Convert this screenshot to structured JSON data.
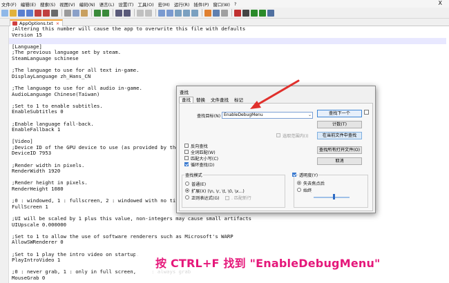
{
  "menu": {
    "items": [
      "文件(F)",
      "编辑(E)",
      "搜索(S)",
      "视图(V)",
      "编码(N)",
      "语言(L)",
      "设置(T)",
      "工具(O)",
      "宏(M)",
      "运行(R)",
      "插件(P)",
      "窗口(W)",
      "?"
    ],
    "close": "X"
  },
  "tab": {
    "label": "AppOptions.txt",
    "close": "×"
  },
  "editor": {
    "lines": [
      ";Altering this number will cause the app to overwrite this file with defaults",
      "Version 15",
      "",
      "[Language]",
      ";The previous language set by steam.",
      "SteamLanguage schinese",
      "",
      ";The language to use for all text in-game.",
      "DisplayLanguage zh_Hans_CN",
      "",
      ";The language to use for all audio in-game.",
      "AudioLanguage Chinese(Taiwan)",
      "",
      ";Set to 1 to enable subtitles.",
      "EnableSubtitles 0",
      "",
      ";Enable language fall-back.",
      "EnableFallback 1",
      "",
      "[Video]",
      ";Device ID of the GPU device to use (as provided by the C",
      "DeviceID 7953",
      "",
      ";Render width in pixels.",
      "RenderWidth 1920",
      "",
      ";Render height in pixels.",
      "RenderHeight 1080",
      "",
      ";0 : windowed, 1 : fullscreen, 2 : windowed with no title",
      "FullScreen 1",
      "",
      ";UI will be scaled by 1 plus this value, non-integers may cause small artifacts",
      "UIUpscale 0.000000",
      "",
      ";Set to 1 to allow the use of software renderers such as Microsoft's WARP",
      "AllowSWRenderer 0",
      "",
      ";Set to 1 play the intro video on startup.",
      "PlayIntroVideo 1",
      "",
      ";0 : never grab, 1 : only in full screen,     : always grab",
      "MouseGrab 0"
    ]
  },
  "find_dialog": {
    "title": "查找",
    "tabs": [
      "查找",
      "替换",
      "文件查找",
      "标记"
    ],
    "find_label": "查找目标(N) :",
    "find_value": "EnableDebugMenu",
    "buttons": {
      "find_next": "查找下一个",
      "count": "计数(T)",
      "find_all_current": "在当前文件中查找",
      "find_all_open": "查找所有打开文件(O)",
      "cancel": "取消"
    },
    "in_selection": "选取范围内(I)",
    "options": [
      "反向查找",
      "全词匹配(W)",
      "匹配大小写(C)",
      "循环查找(D)"
    ],
    "search_mode": {
      "title": "查找模式",
      "normal": "普通(E)",
      "extended": "扩展(X) (\\n, \\r, \\t, \\0, \\x...)",
      "regex": "正则表达式(G)",
      "dot_newline": ". 匹配新行"
    },
    "transparency": {
      "title": "透明度(Y)",
      "on_lose_focus": "失去焦点后",
      "always": "始终",
      "level": 0.55
    }
  },
  "caption": "按 CTRL+F 找到 \"EnableDebugMenu\"",
  "colors": {
    "caption": "#e5177a",
    "arrow": "#e0302c",
    "accent": "#3a7ad0"
  }
}
